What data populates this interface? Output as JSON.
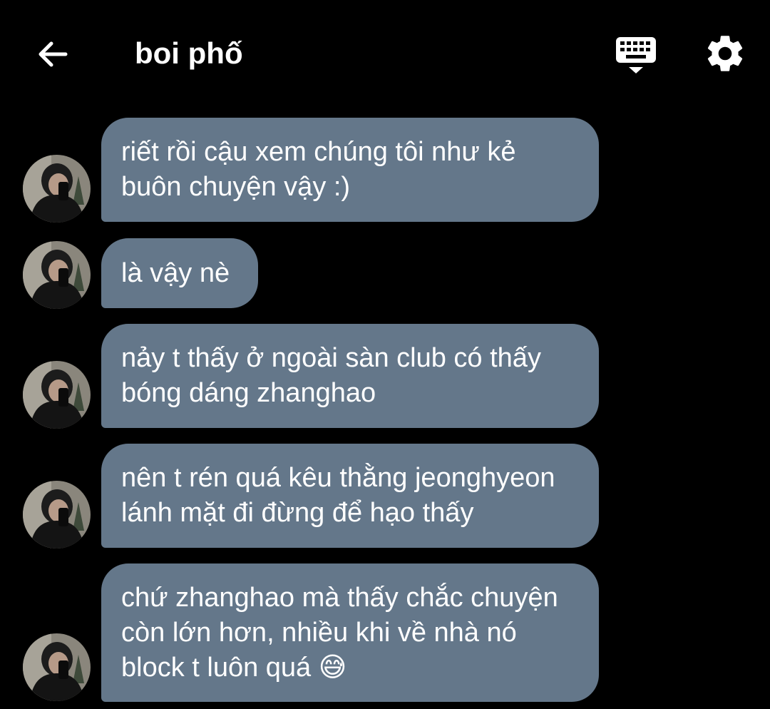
{
  "header": {
    "title": "boi phố",
    "back_icon": "arrow-left-icon",
    "keyboard_icon": "keyboard-hide-icon",
    "settings_icon": "gear-icon"
  },
  "colors": {
    "background": "#000000",
    "bubble": "#64778a",
    "text": "#ffffff"
  },
  "messages": [
    {
      "text": "riết rồi cậu xem chúng tôi như kẻ\nbuôn chuyện vậy :)"
    },
    {
      "text": "là vậy nè"
    },
    {
      "text": "nảy t thấy ở ngoài sàn club có thấy\nbóng dáng zhanghao"
    },
    {
      "text": "nên t rén quá kêu thằng jeonghyeon\nlánh mặt đi đừng để hạo thấy"
    },
    {
      "text": "chứ zhanghao mà thấy chắc chuyện\ncòn lớn hơn, nhiều khi về nhà nó\nblock t luôn quá 😅"
    }
  ]
}
